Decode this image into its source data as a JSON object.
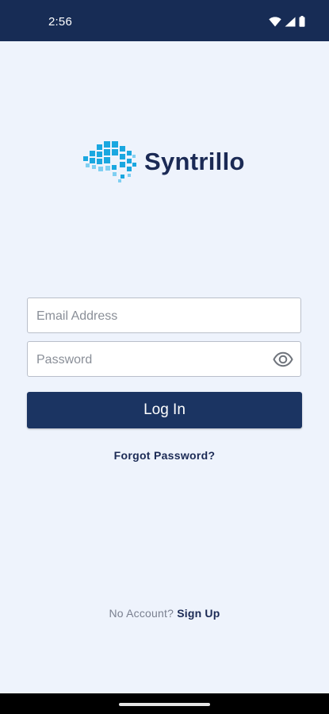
{
  "status_bar": {
    "time": "2:56",
    "icons": [
      "wifi-icon",
      "signal-icon",
      "battery-icon"
    ]
  },
  "logo": {
    "name": "Syntrillo",
    "mark": "pixel-logo-icon"
  },
  "form": {
    "email_placeholder": "Email Address",
    "email_value": "",
    "password_placeholder": "Password",
    "password_value": "",
    "show_password_icon": "eye-icon",
    "login_label": "Log In"
  },
  "forgot_password_label": "Forgot Password?",
  "signup": {
    "prompt": "No Account?",
    "link_label": "Sign Up"
  },
  "colors": {
    "primary": "#1b3462",
    "background": "#eef3fc",
    "status_bar": "#172c55",
    "logo_accent": "#1aa7e0"
  }
}
